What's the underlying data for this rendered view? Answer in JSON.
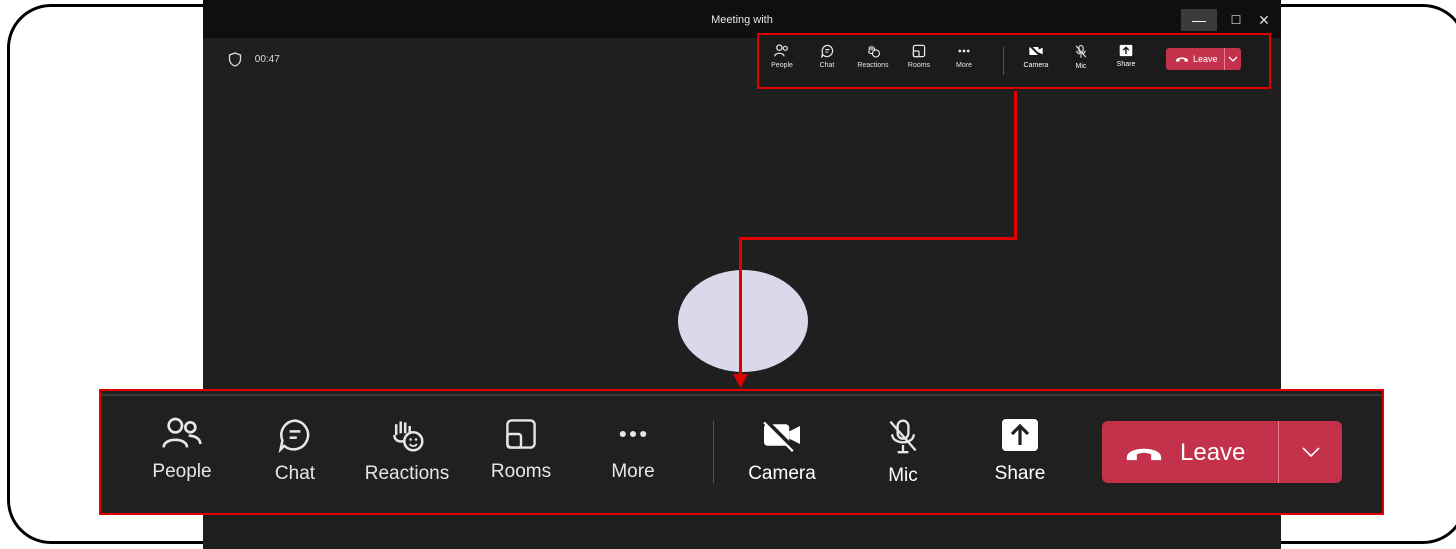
{
  "window": {
    "title": "Meeting with",
    "controls": {
      "minimize": "—",
      "maximize": "☐",
      "close": "✕"
    }
  },
  "meeting": {
    "timer": "00:47",
    "shield_icon": "shield-icon"
  },
  "toolbar": {
    "items": [
      {
        "label": "People",
        "icon": "people-icon"
      },
      {
        "label": "Chat",
        "icon": "chat-icon"
      },
      {
        "label": "Reactions",
        "icon": "reactions-icon"
      },
      {
        "label": "Rooms",
        "icon": "rooms-icon"
      },
      {
        "label": "More",
        "icon": "more-icon"
      },
      {
        "label": "Camera",
        "icon": "camera-off-icon"
      },
      {
        "label": "Mic",
        "icon": "mic-off-icon"
      },
      {
        "label": "Share",
        "icon": "share-icon"
      }
    ],
    "leave_label": "Leave",
    "leave_color": "#c4314b"
  },
  "colors": {
    "highlight": "#e00000",
    "avatar": "#d9d9eb",
    "background": "#1f1f1f"
  }
}
